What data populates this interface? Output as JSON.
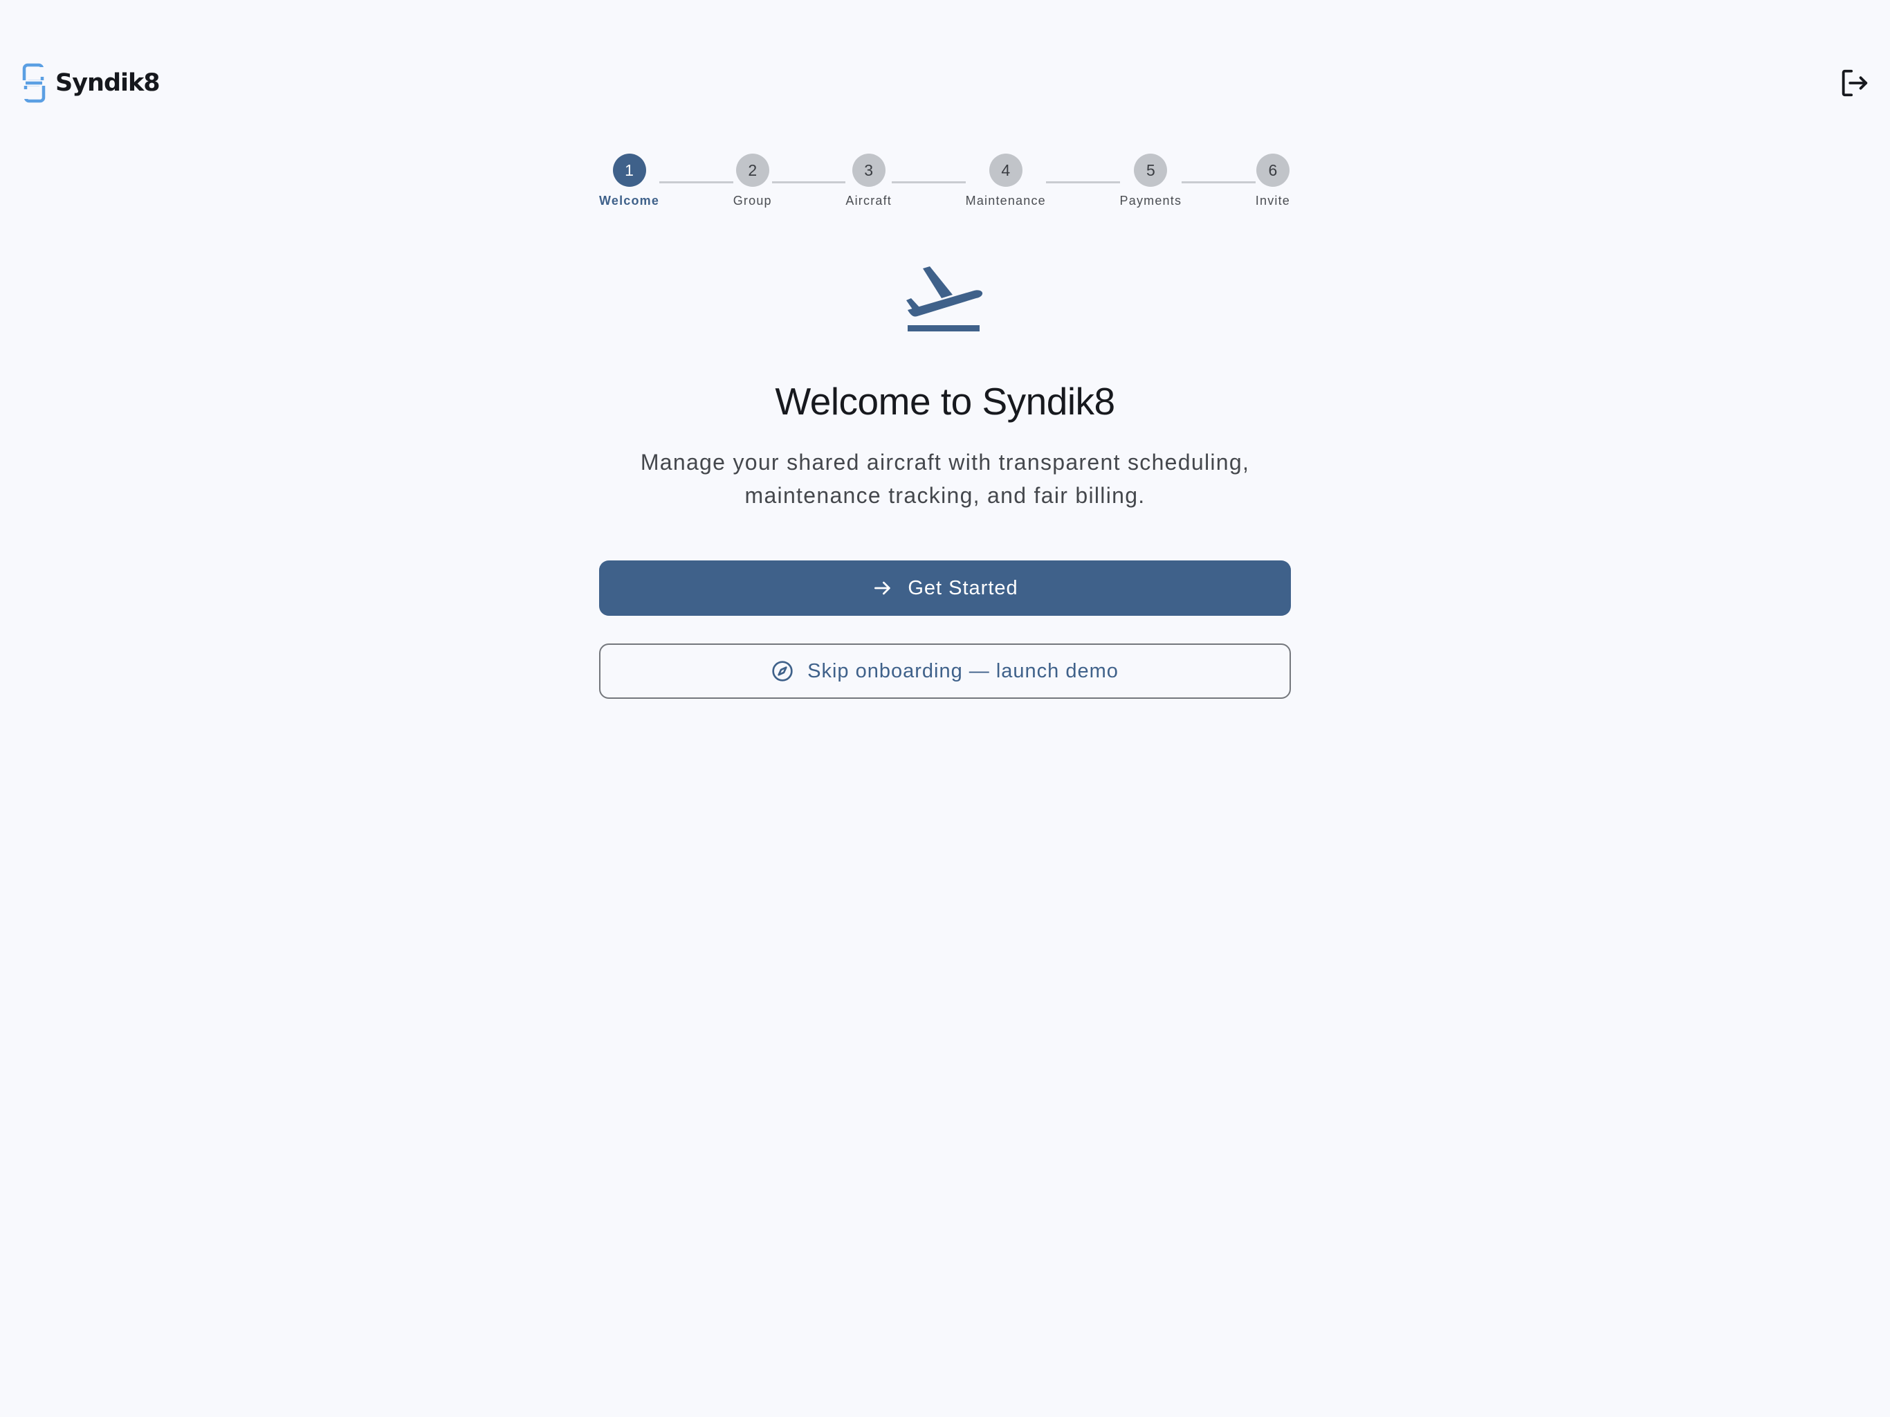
{
  "brand": {
    "name": "Syndik8",
    "logo_icon": "syndik8-logo-icon",
    "accent_color": "#5b9fe3"
  },
  "header": {
    "logout_icon": "logout-icon"
  },
  "stepper": {
    "active_step": 1,
    "steps": [
      {
        "number": "1",
        "label": "Welcome"
      },
      {
        "number": "2",
        "label": "Group"
      },
      {
        "number": "3",
        "label": "Aircraft"
      },
      {
        "number": "4",
        "label": "Maintenance"
      },
      {
        "number": "5",
        "label": "Payments"
      },
      {
        "number": "6",
        "label": "Invite"
      }
    ]
  },
  "hero": {
    "icon": "flight-takeoff-icon",
    "title": "Welcome to Syndik8",
    "subtitle": "Manage your shared aircraft with transparent scheduling, maintenance tracking, and fair billing."
  },
  "actions": {
    "primary_label": "Get Started",
    "primary_icon": "arrow-right-icon",
    "secondary_label": "Skip onboarding — launch demo",
    "secondary_icon": "compass-icon"
  },
  "colors": {
    "primary": "#3f618a",
    "background": "#f8f9fd",
    "inactive_step": "#c1c4c9",
    "connector": "#c9ccd1"
  }
}
